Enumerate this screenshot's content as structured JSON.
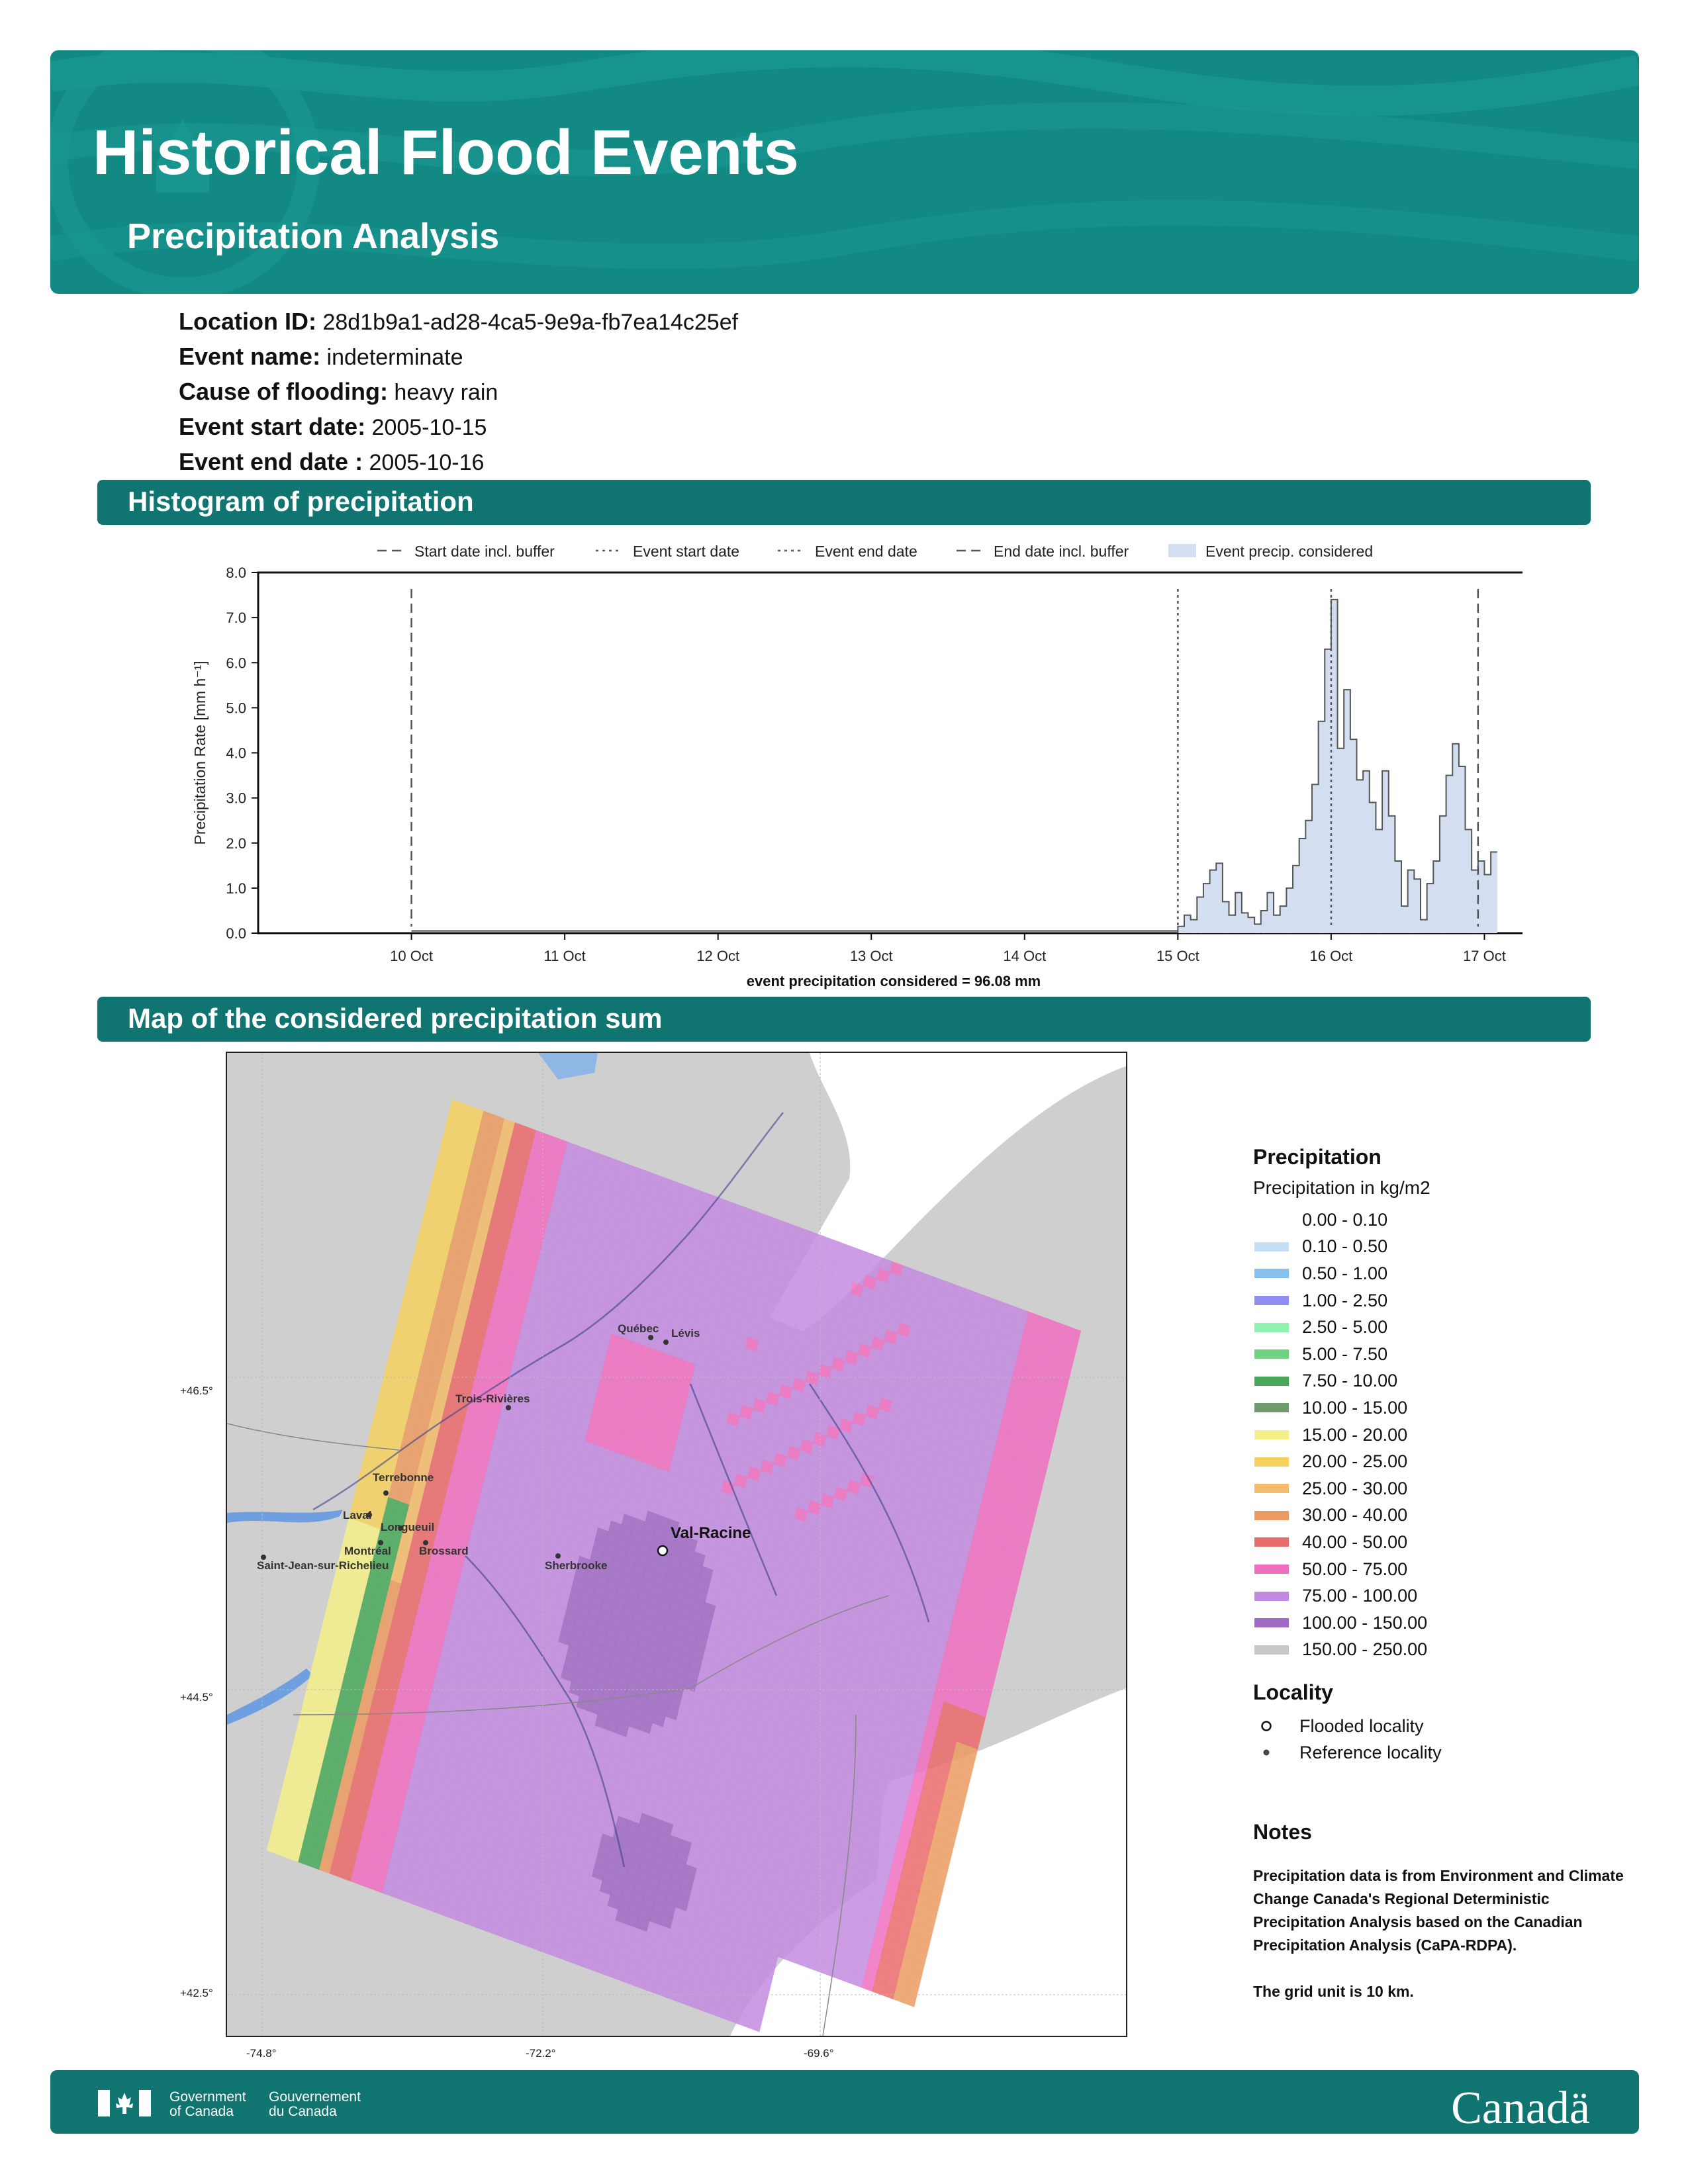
{
  "header": {
    "title": "Historical Flood Events",
    "subtitle": "Precipitation Analysis"
  },
  "event": {
    "location_id_label": "Location ID:",
    "location_id": "28d1b9a1-ad28-4ca5-9e9a-fb7ea14c25ef",
    "event_name_label": "Event name:",
    "event_name": "indeterminate",
    "cause_label": "Cause of flooding:",
    "cause": "heavy rain",
    "start_label": "Event start date:",
    "start": "2005-10-15",
    "end_label": "Event end date :",
    "end": "2005-10-16"
  },
  "sections": {
    "histogram": "Histogram of precipitation",
    "map": "Map of the considered precipitation sum"
  },
  "chart_data": {
    "type": "area",
    "ylabel": "Precipitation Rate [mm h⁻¹]",
    "xlabel": "event precipitation considered = 96.08 mm",
    "ylim": [
      0,
      8
    ],
    "yticks": [
      "0.0",
      "1.0",
      "2.0",
      "3.0",
      "4.0",
      "5.0",
      "6.0",
      "7.0",
      "8.0"
    ],
    "xticks": [
      "10 Oct",
      "11 Oct",
      "12 Oct",
      "13 Oct",
      "14 Oct",
      "15 Oct",
      "16 Oct",
      "17 Oct"
    ],
    "xlim": [
      "2005-10-09 00:00",
      "2005-10-17 07:00"
    ],
    "grid": false,
    "legend_position": "top",
    "legend": [
      "Start date incl. buffer",
      "Event start date",
      "Event end date",
      "End date incl. buffer",
      "Event precip. considered"
    ],
    "markers": {
      "start_incl_buffer": "2005-10-10 00:00",
      "event_start": "2005-10-15 00:00",
      "event_end": "2005-10-16 00:00",
      "end_incl_buffer": "2005-10-16 23:00"
    },
    "background_rate": 0.05,
    "series": [
      {
        "name": "Event precip. considered",
        "start": "2005-10-15 00:00",
        "step_hours": 1,
        "values": [
          0.15,
          0.4,
          0.3,
          0.8,
          1.1,
          1.4,
          1.55,
          0.7,
          0.4,
          0.9,
          0.45,
          0.35,
          0.2,
          0.5,
          0.9,
          0.4,
          0.6,
          1.0,
          1.5,
          2.1,
          2.5,
          3.3,
          4.7,
          6.3,
          7.4,
          4.1,
          5.4,
          4.3,
          3.4,
          3.6,
          2.9,
          2.3,
          3.6,
          2.6,
          1.6,
          0.6,
          1.4,
          1.2,
          0.3,
          1.1,
          1.6,
          2.6,
          3.5,
          4.2,
          3.7,
          2.3,
          1.4,
          1.6,
          1.3,
          1.8
        ]
      }
    ]
  },
  "map": {
    "lat_labels": [
      "+46.5°",
      "+44.5°",
      "+42.5°"
    ],
    "lon_labels": [
      "-74.8°",
      "-72.2°",
      "-69.6°"
    ],
    "flooded_locality": "Val-Racine",
    "reference_localities": [
      "Québec",
      "Lévis",
      "Trois-Rivières",
      "Terrebonne",
      "Laval",
      "Longueuil",
      "Montréal",
      "Brossard",
      "Saint-Jean-sur-Richelieu",
      "Sherbrooke"
    ]
  },
  "legend": {
    "title": "Precipitation",
    "subtitle": "Precipitation in kg/m2",
    "items": [
      {
        "label": "0.00 - 0.10",
        "color": "#ffffff"
      },
      {
        "label": "0.10 - 0.50",
        "color": "#c6dff5"
      },
      {
        "label": "0.50 - 1.00",
        "color": "#86c1f0"
      },
      {
        "label": "1.00 - 2.50",
        "color": "#8f8ef0"
      },
      {
        "label": "2.50 - 5.00",
        "color": "#8ff0b0"
      },
      {
        "label": "5.00 - 7.50",
        "color": "#6fd080"
      },
      {
        "label": "7.50 - 10.00",
        "color": "#4aa85a"
      },
      {
        "label": "10.00 - 15.00",
        "color": "#6f9a6a"
      },
      {
        "label": "15.00 - 20.00",
        "color": "#f5f08a"
      },
      {
        "label": "20.00 - 25.00",
        "color": "#f5d160"
      },
      {
        "label": "25.00 - 30.00",
        "color": "#f2bc6c"
      },
      {
        "label": "30.00 - 40.00",
        "color": "#ec9b63"
      },
      {
        "label": "40.00 - 50.00",
        "color": "#ea6b6b"
      },
      {
        "label": "50.00 - 75.00",
        "color": "#f06ec0"
      },
      {
        "label": "75.00 - 100.00",
        "color": "#c38be0"
      },
      {
        "label": "100.00 - 150.00",
        "color": "#a06ac4"
      },
      {
        "label": "150.00 - 250.00",
        "color": "#c8c8c8"
      }
    ],
    "locality_title": "Locality",
    "flooded_label": "Flooded locality",
    "reference_label": "Reference locality"
  },
  "notes": {
    "title": "Notes",
    "text1": "Precipitation data is from Environment and Climate Change Canada's Regional Deterministic Precipitation Analysis based on the Canadian Precipitation Analysis (CaPA-RDPA).",
    "text2": "The grid unit is 10 km."
  },
  "footer": {
    "gov_en_1": "Government",
    "gov_en_2": "of Canada",
    "gov_fr_1": "Gouvernement",
    "gov_fr_2": "du Canada",
    "wordmark": "Canadä"
  },
  "colors": {
    "banner": "#138984",
    "section_bar": "#107471",
    "precip_fill": "#d3def0"
  }
}
